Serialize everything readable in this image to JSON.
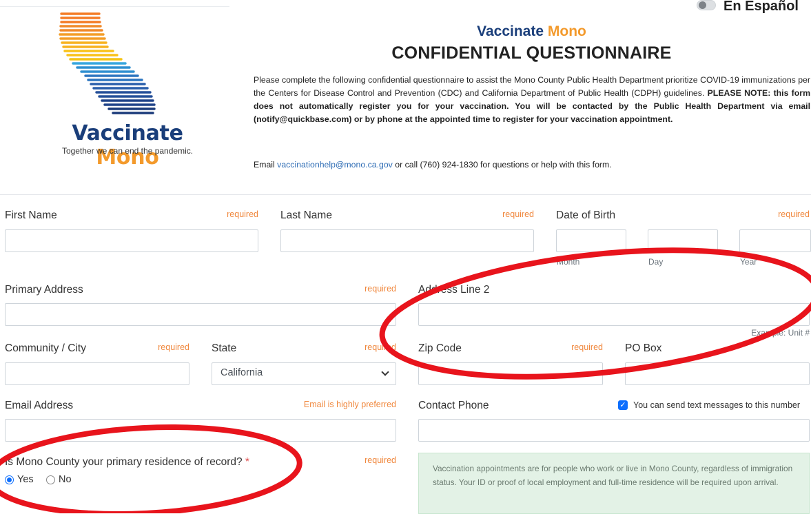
{
  "logo": {
    "title_part1": "Vaccinate",
    "title_part2": "Mono",
    "tagline": "Together we can end the pandemic."
  },
  "language_toggle": {
    "label": "En Español",
    "on": false
  },
  "header": {
    "brand_part1": "Vaccinate",
    "brand_part2": "Mono",
    "title": "CONFIDENTIAL QUESTIONNAIRE",
    "intro": "Please complete the following confidential questionnaire to assist the Mono County Public Health Department prioritize COVID-19 immunizations per the Centers for Disease Control and Prevention (CDC) and California Department of Public Health (CDPH) guidelines.",
    "intro_bold": "PLEASE NOTE: this form does not automatically register you for your vaccination. You will be contacted by the Public Health Department via email (notify@quickbase.com) or by phone at the appointed time to register for your vaccination appointment.",
    "contact_prefix": "Email",
    "contact_email": "vaccinationhelp@mono.ca.gov",
    "contact_suffix": "or call (760) 924-1830 for questions or help with this form."
  },
  "form": {
    "first_name": {
      "label": "First Name",
      "note": "required",
      "value": ""
    },
    "last_name": {
      "label": "Last Name",
      "note": "required",
      "value": ""
    },
    "dob": {
      "label": "Date of Birth",
      "note": "required",
      "month_hint": "Month",
      "day_hint": "Day",
      "year_hint": "Year"
    },
    "primary_address": {
      "label": "Primary Address",
      "note": "required",
      "value": ""
    },
    "address_line2": {
      "label": "Address Line 2",
      "hint": "Example: Unit #",
      "value": ""
    },
    "city": {
      "label": "Community / City",
      "note": "required",
      "value": ""
    },
    "state": {
      "label": "State",
      "note": "required",
      "value": "California"
    },
    "zip": {
      "label": "Zip Code",
      "note": "required",
      "value": ""
    },
    "po_box": {
      "label": "PO Box",
      "value": ""
    },
    "email": {
      "label": "Email Address",
      "note": "Email is highly preferred",
      "value": ""
    },
    "phone": {
      "label": "Contact Phone",
      "checkbox_label": "You can send text messages to this number",
      "checkbox_checked": true,
      "value": ""
    },
    "residence": {
      "label": "Is Mono County your primary residence of record?",
      "asterisk": "*",
      "note": "required",
      "options": [
        "Yes",
        "No"
      ],
      "selected": "Yes"
    },
    "notice": "Vaccination appointments are for people who work or live in Mono County, regardless of immigration status. Your ID or proof of local employment and full-time residence will be required upon arrival."
  },
  "colors": {
    "brand_blue": "#1a3e7a",
    "brand_orange": "#f39a2c",
    "required": "#f0883e",
    "annotation_red": "#e8141c",
    "notice_bg": "#e3f2e6"
  }
}
